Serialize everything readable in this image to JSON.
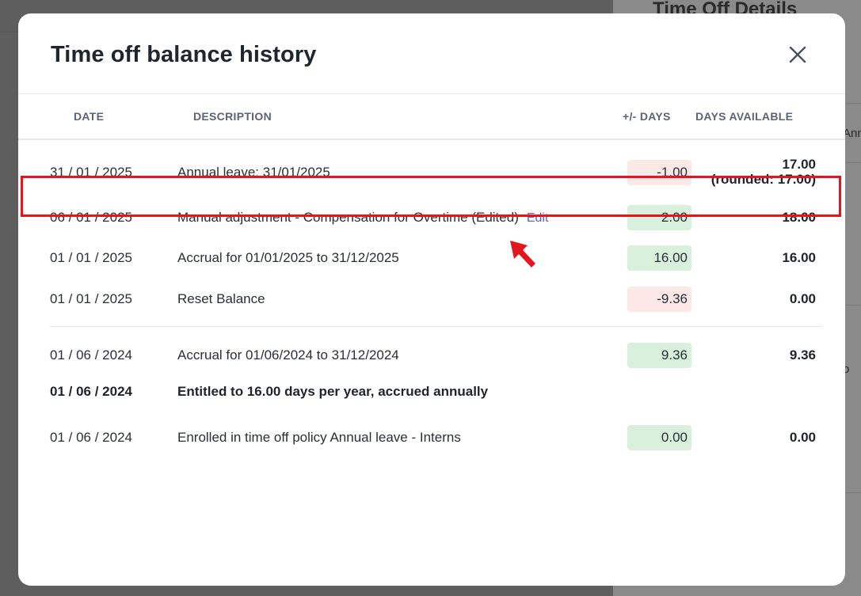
{
  "background": {
    "right_panel_title": "Time Off Details",
    "right_snippet_1": "Ann",
    "right_snippet_2": "o"
  },
  "modal": {
    "title": "Time off balance history",
    "close_icon": "close-icon"
  },
  "table": {
    "headers": {
      "date": "DATE",
      "description": "DESCRIPTION",
      "days_delta": "+/- DAYS",
      "days_available": "DAYS AVAILABLE"
    },
    "rows": [
      {
        "date": "31 / 01 / 2025",
        "description": "Annual leave: 31/01/2025",
        "delta": "-1.00",
        "delta_type": "negative",
        "available": "17.00",
        "available_note": "(rounded: 17.00)"
      },
      {
        "date": "06 / 01 / 2025",
        "description": "Manual adjustment - Compensation for Overtime (Edited)",
        "edit_label": "Edit",
        "delta": "2.00",
        "delta_type": "positive",
        "available": "18.00"
      },
      {
        "date": "01 / 01 / 2025",
        "description": "Accrual for 01/01/2025 to 31/12/2025",
        "delta": "16.00",
        "delta_type": "positive",
        "available": "16.00"
      },
      {
        "date": "01 / 01 / 2025",
        "description": "Reset Balance",
        "delta": "-9.36",
        "delta_type": "negative",
        "available": "0.00"
      },
      {
        "date": "01 / 06 / 2024",
        "description": "Accrual for 01/06/2024 to 31/12/2024",
        "delta": "9.36",
        "delta_type": "positive",
        "available": "9.36"
      },
      {
        "date": "01 / 06 / 2024",
        "description": "Entitled to 16.00 days per year, accrued annually",
        "bold": true
      },
      {
        "date": "01 / 06 / 2024",
        "description": "Enrolled in time off policy Annual leave - Interns",
        "delta": "0.00",
        "delta_type": "positive",
        "available": "0.00"
      }
    ]
  },
  "colors": {
    "negative_pill": "#fde8e8",
    "positive_pill": "#d9f0dd",
    "highlight": "#e3161d",
    "edit_link": "#5b63c9"
  }
}
